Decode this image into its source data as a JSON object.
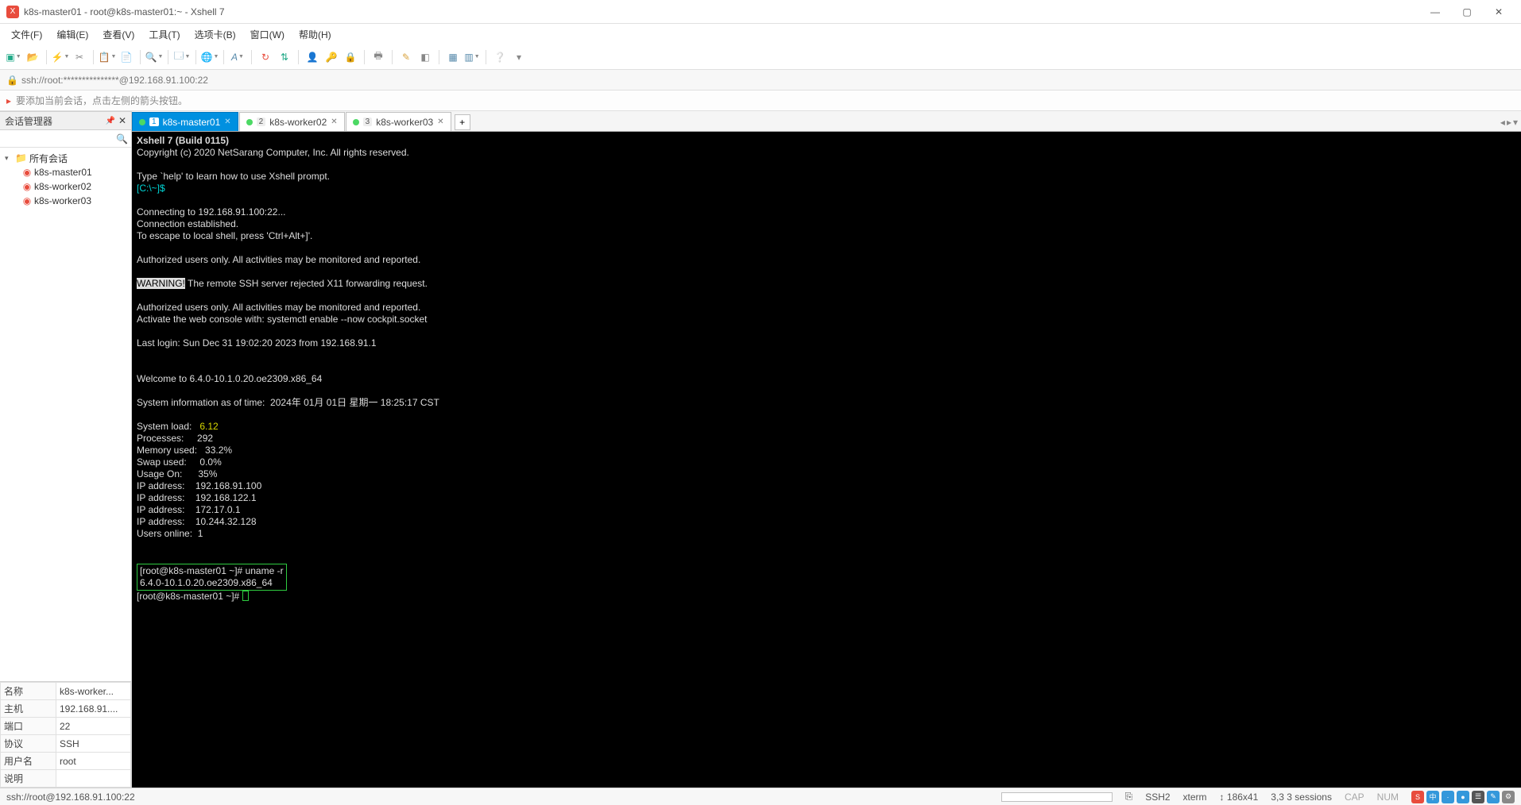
{
  "window": {
    "title": "k8s-master01 - root@k8s-master01:~ - Xshell 7"
  },
  "menu": [
    "文件(F)",
    "编辑(E)",
    "查看(V)",
    "工具(T)",
    "选项卡(B)",
    "窗口(W)",
    "帮助(H)"
  ],
  "address": "ssh://root:***************@192.168.91.100:22",
  "hint": "要添加当前会话，点击左侧的箭头按钮。",
  "sidebar": {
    "title": "会话管理器",
    "root": "所有会话",
    "items": [
      "k8s-master01",
      "k8s-worker02",
      "k8s-worker03"
    ]
  },
  "props": [
    {
      "k": "名称",
      "v": "k8s-worker..."
    },
    {
      "k": "主机",
      "v": "192.168.91...."
    },
    {
      "k": "端口",
      "v": "22"
    },
    {
      "k": "协议",
      "v": "SSH"
    },
    {
      "k": "用户名",
      "v": "root"
    },
    {
      "k": "说明",
      "v": ""
    }
  ],
  "tabs": [
    {
      "num": "1",
      "label": "k8s-master01",
      "active": true
    },
    {
      "num": "2",
      "label": "k8s-worker02",
      "active": false
    },
    {
      "num": "3",
      "label": "k8s-worker03",
      "active": false
    }
  ],
  "term": {
    "l1": "Xshell 7 (Build 0115)",
    "l2": "Copyright (c) 2020 NetSarang Computer, Inc. All rights reserved.",
    "l3": "Type `help' to learn how to use Xshell prompt.",
    "prompt1": "[C:\\~]$",
    "l4": "Connecting to 192.168.91.100:22...",
    "l5": "Connection established.",
    "l6": "To escape to local shell, press 'Ctrl+Alt+]'.",
    "l7": "Authorized users only. All activities may be monitored and reported.",
    "warn": "WARNING!",
    "l8": " The remote SSH server rejected X11 forwarding request.",
    "l9": "Authorized users only. All activities may be monitored and reported.",
    "l10": "Activate the web console with: systemctl enable --now cockpit.socket",
    "l11": "Last login: Sun Dec 31 19:02:20 2023 from 192.168.91.1",
    "l12": "Welcome to 6.4.0-10.1.0.20.oe2309.x86_64",
    "l13": "System information as of time:  2024年 01月 01日 星期一 18:25:17 CST",
    "sys": [
      {
        "k": "System load:   ",
        "v": "6.12",
        "y": true
      },
      {
        "k": "Processes:     ",
        "v": "292"
      },
      {
        "k": "Memory used:   ",
        "v": "33.2%"
      },
      {
        "k": "Swap used:     ",
        "v": "0.0%"
      },
      {
        "k": "Usage On:      ",
        "v": "35%"
      },
      {
        "k": "IP address:    ",
        "v": "192.168.91.100"
      },
      {
        "k": "IP address:    ",
        "v": "192.168.122.1"
      },
      {
        "k": "IP address:    ",
        "v": "172.17.0.1"
      },
      {
        "k": "IP address:    ",
        "v": "10.244.32.128"
      },
      {
        "k": "Users online:  ",
        "v": "1"
      }
    ],
    "cmd_prompt": "[root@k8s-master01 ~]# ",
    "cmd": "uname -r",
    "cmd_out": "6.4.0-10.1.0.20.oe2309.x86_64",
    "prompt2": "[root@k8s-master01 ~]# "
  },
  "status": {
    "left": "ssh://root@192.168.91.100:22",
    "ssh": "SSH2",
    "term": "xterm",
    "size": "186x41",
    "caps": "CAP",
    "num": "NUM"
  }
}
